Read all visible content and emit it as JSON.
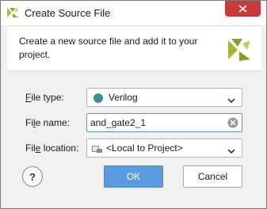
{
  "window": {
    "title": "Create Source File"
  },
  "banner": {
    "description": "Create a new source file and add it to your project."
  },
  "form": {
    "file_type": {
      "label_prefix": "F",
      "label_rest": "ile type:",
      "value": "Verilog",
      "dot_color": "#3a8a9a"
    },
    "file_name": {
      "label_prefix": "Fi",
      "label_underline": "l",
      "label_rest": "e name:",
      "value": "and_gate2_1"
    },
    "file_location": {
      "label_prefix": "Fil",
      "label_underline": "e",
      "label_rest": " location:",
      "value": "<Local to Project>"
    }
  },
  "buttons": {
    "help": "?",
    "ok": "OK",
    "cancel": "Cancel"
  },
  "colors": {
    "ok_button": "#5b9be0",
    "close_button": "#c7393a",
    "focus_border": "#5a93d6"
  }
}
